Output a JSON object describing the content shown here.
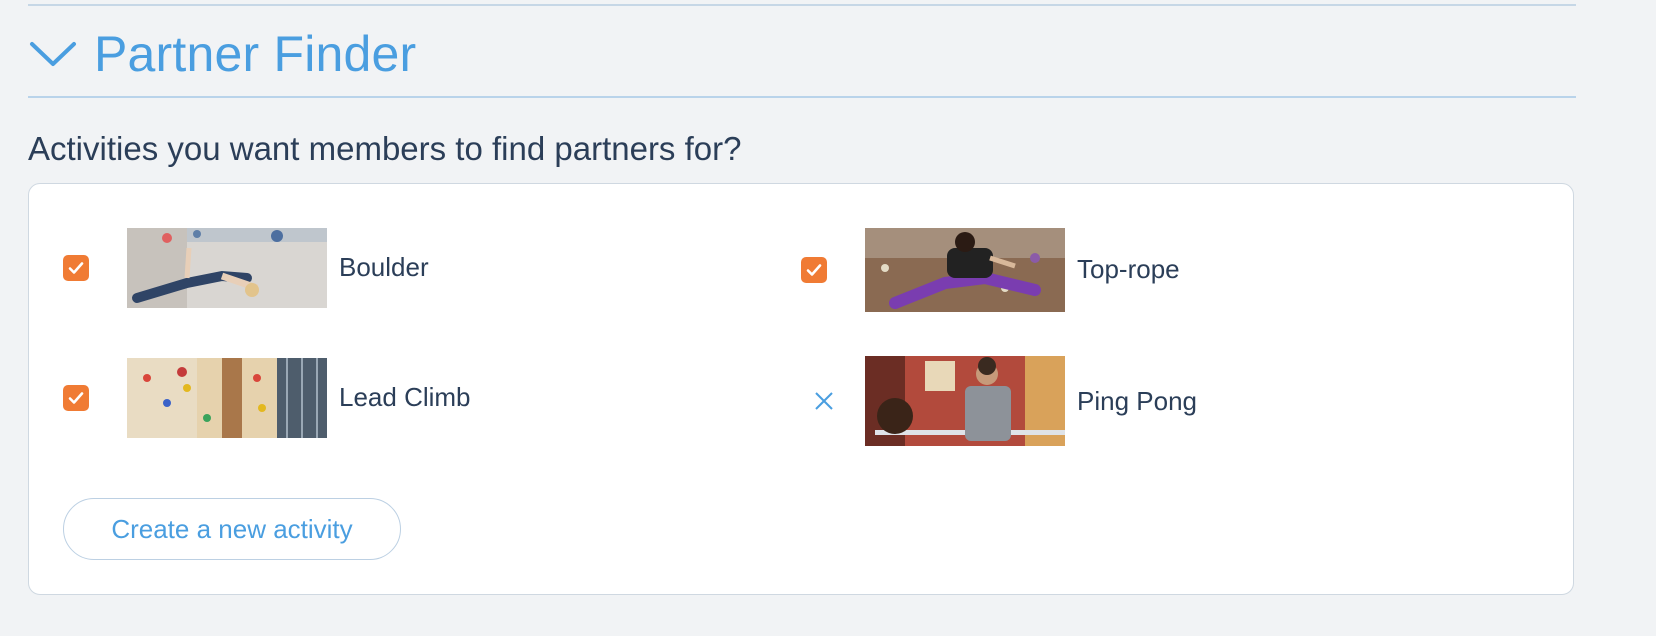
{
  "section": {
    "title": "Partner Finder",
    "question": "Activities you want members to find partners for?"
  },
  "activities": [
    {
      "label": "Boulder",
      "checked": true
    },
    {
      "label": "Top-rope",
      "checked": true
    },
    {
      "label": "Lead Climb",
      "checked": true
    },
    {
      "label": "Ping Pong",
      "checked": false
    }
  ],
  "create_button": {
    "label": "Create a new activity"
  },
  "colors": {
    "accent": "#4a9ee0",
    "checkbox": "#f07b34",
    "text": "#2b3e58",
    "background": "#f1f3f5"
  },
  "icons": {
    "collapse": "chevron-down-icon",
    "checked": "checkmark-icon",
    "remove": "close-icon"
  }
}
